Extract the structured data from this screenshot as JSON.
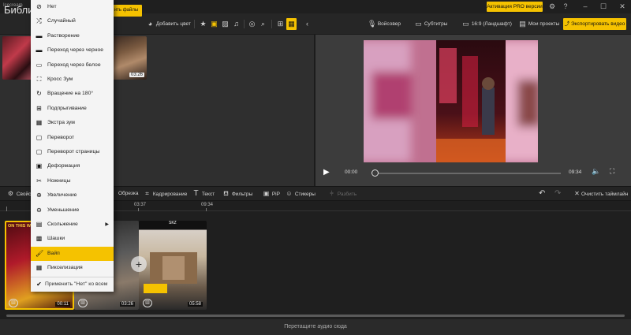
{
  "app": {
    "window_title": "Icecream"
  },
  "titlebar": {
    "pro_button": "Активация PRO версии",
    "icons": [
      "gear-icon",
      "help-icon",
      "minimize-icon",
      "maximize-icon",
      "close-icon"
    ],
    "glyphs": [
      "⚙",
      "?",
      "–",
      "☐",
      "✕"
    ]
  },
  "toolbar": {
    "library_title": "Библи",
    "add_files": "ить файлы",
    "add_color": "Добавить цвет",
    "voiceover": "Войсовер",
    "subtitles": "Субтитры",
    "aspect": "16:9 (Ландшафт)",
    "my_projects": "Мои проекты",
    "export": "Экспортировать видео"
  },
  "library": {
    "items": [
      {
        "duration": ""
      },
      {
        "duration": "03:26"
      }
    ]
  },
  "player": {
    "current_time": "00:00",
    "total_time": "09:34",
    "progress": 0
  },
  "edit_bar": {
    "properties": "Свойс",
    "crop": "Обрезка",
    "framing": "Кадрирование",
    "text": "Текст",
    "filters": "Фильтры",
    "pip": "PiP",
    "stickers": "Стикеры",
    "split": "Разбить",
    "clear_timeline": "Очистить таймлайн"
  },
  "timeline": {
    "ruler_labels": [
      "03:37",
      "09:34"
    ],
    "clips": [
      {
        "duration": "00:11",
        "selected": true,
        "overlay": "ON THIS WAY"
      },
      {
        "duration": "03:26",
        "selected": false
      },
      {
        "duration": "05:58",
        "selected": false,
        "overlay": "SKZ"
      }
    ],
    "audio_drop": "Перетащите аудио сюда"
  },
  "transition_menu": {
    "items": [
      {
        "label": "Нет",
        "icon": "none-icon",
        "glyph": "⊘"
      },
      {
        "label": "Случайный",
        "icon": "random-icon",
        "glyph": "⤮"
      },
      {
        "label": "Растворение",
        "icon": "dissolve-icon",
        "glyph": "▬"
      },
      {
        "label": "Переход через черное",
        "icon": "fade-black-icon",
        "glyph": "▬"
      },
      {
        "label": "Переход через белое",
        "icon": "fade-white-icon",
        "glyph": "▭"
      },
      {
        "label": "Кросс Зум",
        "icon": "cross-zoom-icon",
        "glyph": "⛶"
      },
      {
        "label": "Вращение на 180°",
        "icon": "rotate-icon",
        "glyph": "↻"
      },
      {
        "label": "Подпрыгивание",
        "icon": "bounce-icon",
        "glyph": "⊞"
      },
      {
        "label": "Экстра зум",
        "icon": "extra-zoom-icon",
        "glyph": "▦"
      },
      {
        "label": "Переворот",
        "icon": "flip-icon",
        "glyph": "▢"
      },
      {
        "label": "Переворот страницы",
        "icon": "page-flip-icon",
        "glyph": "▢"
      },
      {
        "label": "Деформация",
        "icon": "deform-icon",
        "glyph": "▣"
      },
      {
        "label": "Ножницы",
        "icon": "scissors-icon",
        "glyph": "✂"
      },
      {
        "label": "Увеличение",
        "icon": "zoom-in-icon",
        "glyph": "⊕"
      },
      {
        "label": "Уменьшение",
        "icon": "zoom-out-icon",
        "glyph": "⊖"
      },
      {
        "label": "Скольжение",
        "icon": "slide-icon",
        "glyph": "▤",
        "submenu": true
      },
      {
        "label": "Шашки",
        "icon": "checker-icon",
        "glyph": "▩"
      },
      {
        "label": "Вайп",
        "icon": "wipe-icon",
        "glyph": "🖌",
        "highlighted": true
      },
      {
        "label": "Пикселизация",
        "icon": "pixelate-icon",
        "glyph": "▦"
      }
    ],
    "apply_all": "Применить \"Нет\" ко всем",
    "apply_glyph": "✔"
  },
  "colors": {
    "accent": "#f5c200",
    "background": "#1e1e1e",
    "menu_bg": "#f4f4f4"
  }
}
